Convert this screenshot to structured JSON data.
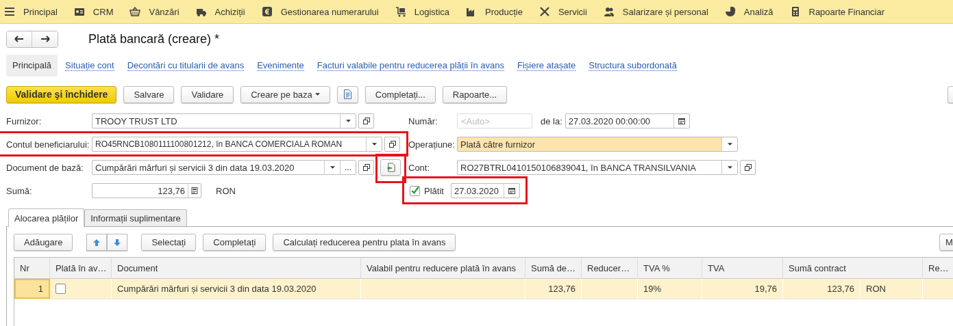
{
  "menu": [
    {
      "label": "Principal"
    },
    {
      "label": "CRM"
    },
    {
      "label": "Vânzări"
    },
    {
      "label": "Achiziții"
    },
    {
      "label": "Gestionarea numerarului"
    },
    {
      "label": "Logistica"
    },
    {
      "label": "Producție"
    },
    {
      "label": "Servicii"
    },
    {
      "label": "Salarizare și personal"
    },
    {
      "label": "Analiză"
    },
    {
      "label": "Rapoarte Financiar"
    }
  ],
  "title": "Plată bancară (creare) *",
  "sections": [
    {
      "label": "Principală",
      "selected": true
    },
    {
      "label": "Situație cont",
      "selected": false
    },
    {
      "label": "Decontări cu titularii de avans",
      "selected": false
    },
    {
      "label": "Evenimente",
      "selected": false
    },
    {
      "label": "Facturi valabile pentru reducerea plății în avans",
      "selected": false
    },
    {
      "label": "Fișiere atașate",
      "selected": false
    },
    {
      "label": "Structura subordonată",
      "selected": false
    }
  ],
  "toolbar": [
    {
      "kind": "primary",
      "label": "Validare şi închidere"
    },
    {
      "kind": "button",
      "label": "Salvare"
    },
    {
      "kind": "button",
      "label": "Validare"
    },
    {
      "kind": "dropdown",
      "label": "Creare pe baza"
    },
    {
      "kind": "icon"
    },
    {
      "kind": "button",
      "label": "Completați..."
    },
    {
      "kind": "button",
      "label": "Rapoarte..."
    },
    {
      "kind": "edge"
    }
  ],
  "form_rows": [
    {
      "left": {
        "kind": "select",
        "label": "Furnizor:",
        "value": "TROOY TRUST LTD",
        "marked": false
      },
      "right": {
        "kind": "number-date",
        "label": "Număr:",
        "placeholder": "<Auto>",
        "date_label": "de la:",
        "date": "27.03.2020 00:00:00"
      }
    },
    {
      "left": {
        "kind": "select",
        "label": "Contul beneficiarului:",
        "value": "RO45RNCB1080111100801212, în BANCA COMERCIALA ROMAN",
        "marked": true
      },
      "right": {
        "kind": "select",
        "label": "Operațiune:",
        "value": "Plată către furnizor",
        "tinted": true,
        "open_button": false
      }
    },
    {
      "left": {
        "kind": "document",
        "label": "Document de bază:",
        "value": "Cumpărări mărfuri și servicii 3 din data 19.03.2020",
        "marked": false,
        "choose_label": "...",
        "extra_marked": true
      },
      "right": {
        "kind": "select",
        "label": "Cont:",
        "value": "RO27BTRL0410150106839041, în BANCA TRANSILVANIA",
        "tinted": false,
        "open_button": true
      }
    },
    {
      "left": {
        "kind": "amount",
        "label": "Sumă:",
        "value": "123,76",
        "unit": "RON"
      },
      "right": {
        "kind": "check-date",
        "label": "Plătit",
        "checked": true,
        "date": "27.03.2020",
        "marked": true
      }
    }
  ],
  "tabs": [
    {
      "label": "Alocarea plăților",
      "selected": true
    },
    {
      "label": "Informații suplimentare",
      "selected": false
    }
  ],
  "table_toolbar": [
    {
      "kind": "button",
      "label": "Adăugare"
    },
    {
      "kind": "arrows"
    },
    {
      "kind": "button",
      "label": "Selectați"
    },
    {
      "kind": "button",
      "label": "Completați"
    },
    {
      "kind": "button",
      "label": "Calculați reducerea pentru plata în avans"
    },
    {
      "kind": "edge",
      "label": "M"
    }
  ],
  "table": {
    "columns": [
      "Nr",
      "Plată în av…",
      "Document",
      "Valabil pentru reducere plată în avans",
      "Sumă de…",
      "Reducer…",
      "TVA %",
      "TVA",
      "Sumă contract",
      "Re…"
    ],
    "rows": [
      {
        "selected": true,
        "cells": [
          {
            "kind": "index",
            "text": "1",
            "focused": true
          },
          {
            "kind": "checkbox",
            "checked": false
          },
          {
            "kind": "text",
            "text": "Cumpărări mărfuri și servicii 3 din data 19.03.2020"
          },
          {
            "kind": "empty"
          },
          {
            "kind": "number",
            "text": "123,76"
          },
          {
            "kind": "empty"
          },
          {
            "kind": "text",
            "text": "19%"
          },
          {
            "kind": "number",
            "text": "19,76"
          },
          {
            "kind": "number",
            "text": "123,76"
          },
          {
            "kind": "text",
            "text": "RON"
          },
          {
            "kind": "empty"
          }
        ]
      }
    ]
  }
}
